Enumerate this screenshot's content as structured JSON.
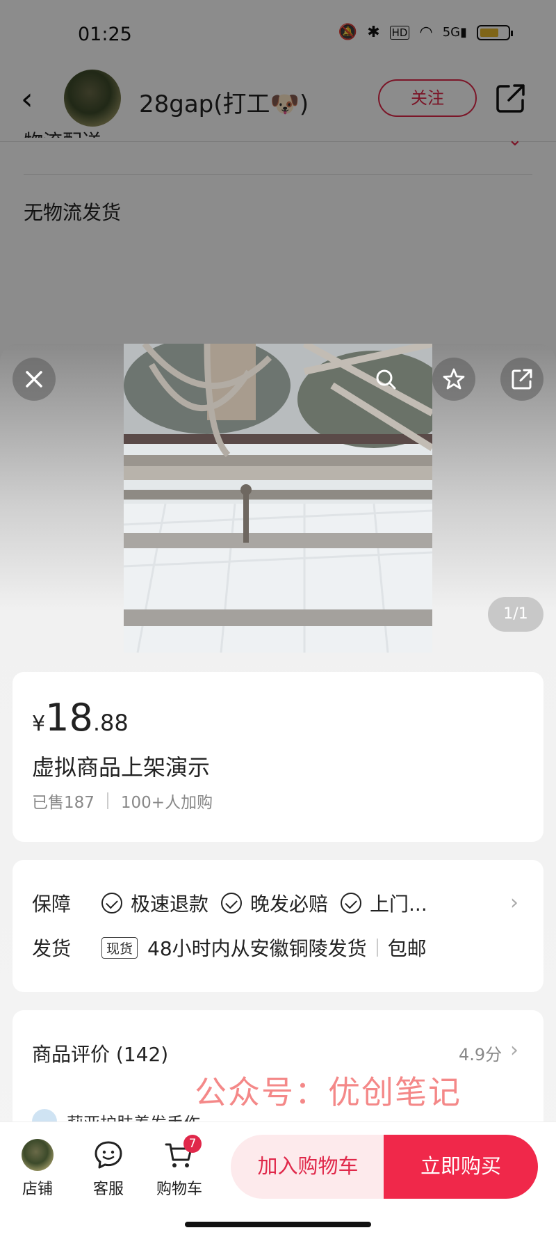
{
  "status_bar": {
    "time": "01:25",
    "icons": [
      "mute-icon",
      "bluetooth-icon",
      "hd-icon",
      "wifi-icon",
      "5g-signal-icon",
      "battery-icon"
    ]
  },
  "header": {
    "shop_name": "28gap(打工🐶)",
    "follow_label": "关注"
  },
  "background_page": {
    "section_label": "物流配送",
    "logistics_value": "无物流发货"
  },
  "gallery": {
    "page_indicator": "1/1"
  },
  "product": {
    "currency": "¥",
    "price_integer": "18",
    "price_decimal": ".88",
    "title": "虚拟商品上架演示",
    "sold": "已售187",
    "cart_adds": "100+人加购"
  },
  "guarantee": {
    "label": "保障",
    "items": [
      "极速退款",
      "晚发必赔",
      "上门..."
    ]
  },
  "shipping": {
    "label": "发货",
    "tag": "现货",
    "detail": "48小时内从安徽铜陵发货",
    "free_shipping": "包邮"
  },
  "reviews": {
    "title": "商品评价 (142)",
    "score": "4.9分",
    "watermark": "公众号：优创笔记",
    "first_reviewer": "莉亚护肤养发手作"
  },
  "bottom_bar": {
    "store_label": "店铺",
    "service_label": "客服",
    "cart_label": "购物车",
    "cart_count": "7",
    "add_to_cart_label": "加入购物车",
    "buy_now_label": "立即购买"
  },
  "colors": {
    "accent": "#e0284a",
    "buy_button": "#f0284a",
    "add_cart_bg": "#fdeaec"
  }
}
